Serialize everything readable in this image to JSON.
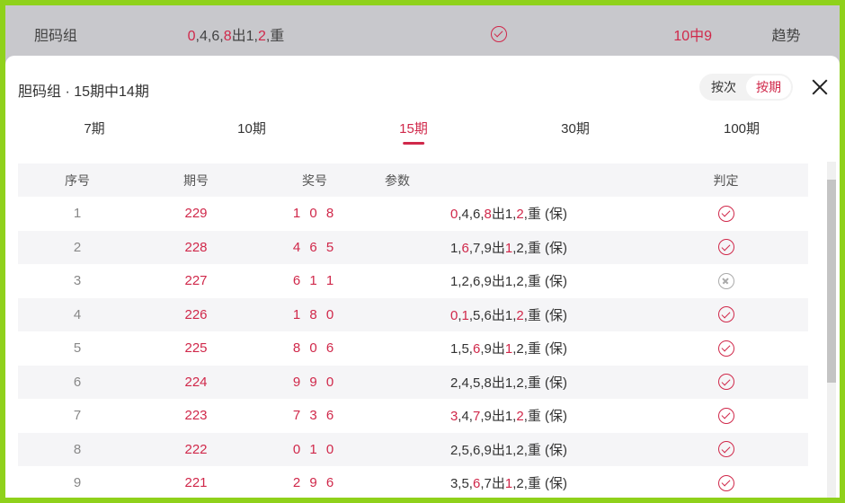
{
  "background_row": {
    "name": "胆码组",
    "params": [
      {
        "t": "0",
        "r": true
      },
      {
        "t": ",4,6,",
        "r": false
      },
      {
        "t": "8",
        "r": true
      },
      {
        "t": "出1,",
        "r": false
      },
      {
        "t": "2",
        "r": true
      },
      {
        "t": ",重",
        "r": false
      }
    ],
    "result": "10中9",
    "trend": "趋势"
  },
  "modal": {
    "title": "胆码组 · 15期中14期",
    "toggle": {
      "by_count": "按次",
      "by_period": "按期",
      "active": "by_period"
    },
    "tabs": [
      {
        "label": "7期",
        "active": false
      },
      {
        "label": "10期",
        "active": false
      },
      {
        "label": "15期",
        "active": true
      },
      {
        "label": "30期",
        "active": false
      },
      {
        "label": "100期",
        "active": false
      }
    ],
    "table": {
      "headers": {
        "index": "序号",
        "period": "期号",
        "number": "奖号",
        "params": "参数",
        "verdict": "判定"
      },
      "rows": [
        {
          "index": "1",
          "period": "229",
          "number": "1 0 8",
          "params": [
            {
              "t": "0",
              "r": true
            },
            {
              "t": ",4,6,",
              "r": false
            },
            {
              "t": "8",
              "r": true
            },
            {
              "t": "出1,",
              "r": false
            },
            {
              "t": "2",
              "r": true
            },
            {
              "t": ",重 (保)",
              "r": false
            }
          ],
          "hit": true
        },
        {
          "index": "2",
          "period": "228",
          "number": "4 6 5",
          "params": [
            {
              "t": "1,",
              "r": false
            },
            {
              "t": "6",
              "r": true
            },
            {
              "t": ",7,9出",
              "r": false
            },
            {
              "t": "1",
              "r": true
            },
            {
              "t": ",2,重 (保)",
              "r": false
            }
          ],
          "hit": true
        },
        {
          "index": "3",
          "period": "227",
          "number": "6 1 1",
          "params": [
            {
              "t": "1,2,6,9出1,2,重 (保)",
              "r": false
            }
          ],
          "hit": false
        },
        {
          "index": "4",
          "period": "226",
          "number": "1 8 0",
          "params": [
            {
              "t": "0",
              "r": true
            },
            {
              "t": ",",
              "r": false
            },
            {
              "t": "1",
              "r": true
            },
            {
              "t": ",5,6出1,",
              "r": false
            },
            {
              "t": "2",
              "r": true
            },
            {
              "t": ",重 (保)",
              "r": false
            }
          ],
          "hit": true
        },
        {
          "index": "5",
          "period": "225",
          "number": "8 0 6",
          "params": [
            {
              "t": "1,5,",
              "r": false
            },
            {
              "t": "6",
              "r": true
            },
            {
              "t": ",9出",
              "r": false
            },
            {
              "t": "1",
              "r": true
            },
            {
              "t": ",2,重 (保)",
              "r": false
            }
          ],
          "hit": true
        },
        {
          "index": "6",
          "period": "224",
          "number": "9 9 0",
          "params": [
            {
              "t": "2,4,5,8出1,2,重 (保)",
              "r": false
            }
          ],
          "hit": true
        },
        {
          "index": "7",
          "period": "223",
          "number": "7 3 6",
          "params": [
            {
              "t": "3",
              "r": true
            },
            {
              "t": ",4,",
              "r": false
            },
            {
              "t": "7",
              "r": true
            },
            {
              "t": ",9出1,",
              "r": false
            },
            {
              "t": "2",
              "r": true
            },
            {
              "t": ",重 (保)",
              "r": false
            }
          ],
          "hit": true
        },
        {
          "index": "8",
          "period": "222",
          "number": "0 1 0",
          "params": [
            {
              "t": "2,5,6,9出1,2,重 (保)",
              "r": false
            }
          ],
          "hit": true
        },
        {
          "index": "9",
          "period": "221",
          "number": "2 9 6",
          "params": [
            {
              "t": "3,5,",
              "r": false
            },
            {
              "t": "6",
              "r": true
            },
            {
              "t": ",7出",
              "r": false
            },
            {
              "t": "1",
              "r": true
            },
            {
              "t": ",2,重 (保)",
              "r": false
            }
          ],
          "hit": true
        }
      ]
    }
  },
  "colors": {
    "accent": "#d0284a",
    "frame": "#8fd11b"
  }
}
